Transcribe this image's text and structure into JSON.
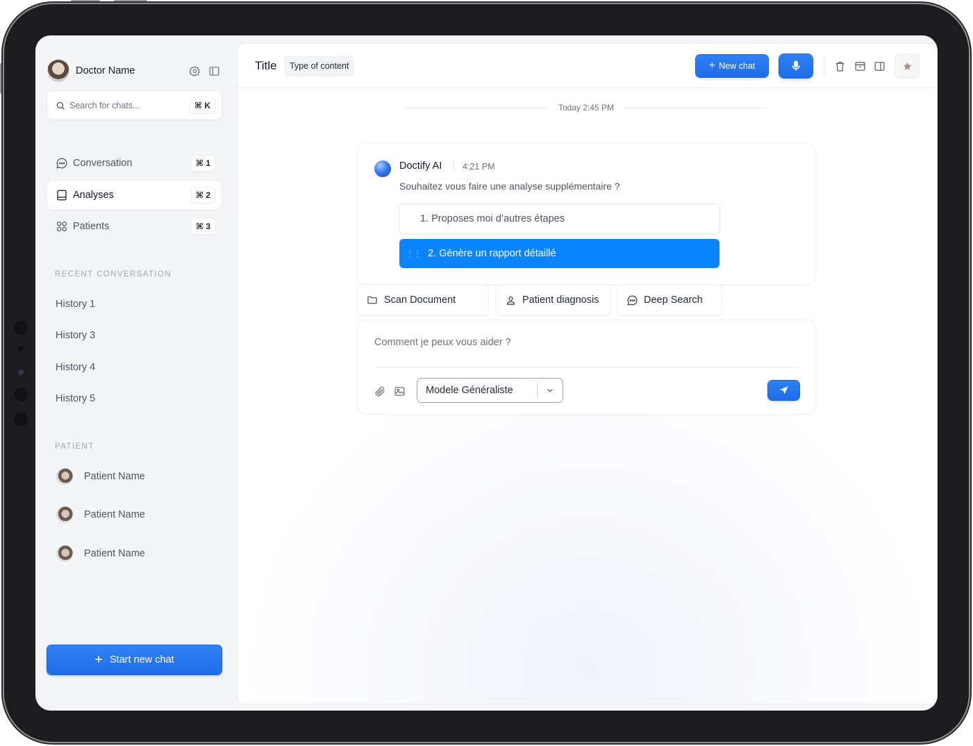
{
  "sidebar": {
    "doctor_name": "Doctor Name",
    "search": {
      "placeholder": "Search for chats...",
      "shortcut": "⌘ K"
    },
    "nav": [
      {
        "label": "Conversation",
        "shortcut": "⌘ 1",
        "icon": "chat-bubble-icon",
        "active": false
      },
      {
        "label": "Analyses",
        "shortcut": "⌘ 2",
        "icon": "book-icon",
        "active": true
      },
      {
        "label": "Patients",
        "shortcut": "⌘ 3",
        "icon": "grid-circles-icon",
        "active": false
      }
    ],
    "recent_title": "RECENT CONVERSATION",
    "history": [
      "History 1",
      "History 3",
      "History 4",
      "History 5"
    ],
    "patient_title": "PATIENT",
    "patients": [
      "Patient Name",
      "Patient Name",
      "Patient Name"
    ],
    "start_button": "Start new chat"
  },
  "header": {
    "title": "Title",
    "type_badge": "Type of content",
    "new_chat": "New chat",
    "icons": [
      "microphone-icon",
      "trash-icon",
      "archive-icon",
      "sidebar-toggle-icon",
      "star-icon"
    ]
  },
  "chat": {
    "date_separator": "Today 2:45 PM",
    "message": {
      "sender": "Doctify AI",
      "time": "4:21 PM",
      "text": "Souhaitez vous faire une analyse supplémentaire ?",
      "options": [
        {
          "label": "1.  Proposes moi d’autres étapes",
          "selected": false
        },
        {
          "label": "2.  Génère un rapport détaillé",
          "selected": true
        }
      ]
    },
    "quick_actions": [
      "Scan Document",
      "Patient diagnosis",
      "Deep Search"
    ]
  },
  "composer": {
    "placeholder": "Comment je peux vous aider ?",
    "model": "Modele Généraliste"
  },
  "colors": {
    "accent": "#1f6ee8",
    "selected_option": "#0a84ff",
    "sidebar_bg": "#f4f5f7",
    "device_frame": "#1c1c1e"
  }
}
